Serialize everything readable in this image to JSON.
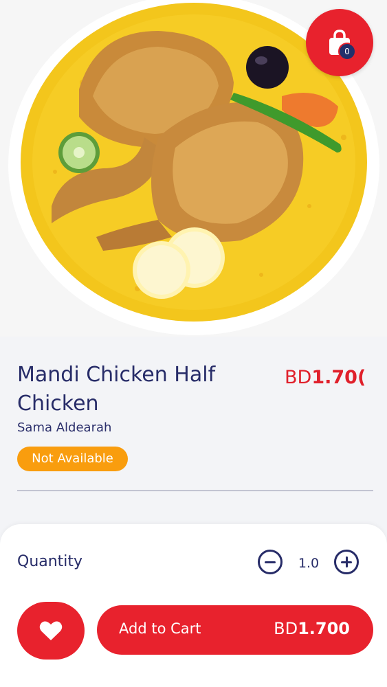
{
  "product": {
    "name": "Mandi Chicken Half Chicken",
    "vendor": "Sama Aldearah",
    "availability": "Not Available",
    "currency": "BD",
    "price": "1.700",
    "price_truncated": "1.70("
  },
  "cart": {
    "count": "0"
  },
  "quantity": {
    "label": "Quantity",
    "value": "1.0"
  },
  "actions": {
    "add_to_cart_label": "Add to Cart",
    "currency": "BD",
    "price": "1.700"
  },
  "icons": {
    "cart": "shopping-bag-icon",
    "favorite": "heart-icon",
    "decrement": "minus-circle-icon",
    "increment": "plus-circle-icon"
  },
  "colors": {
    "accent": "#e8222d",
    "navy": "#272c68",
    "status": "#f99d0e"
  }
}
